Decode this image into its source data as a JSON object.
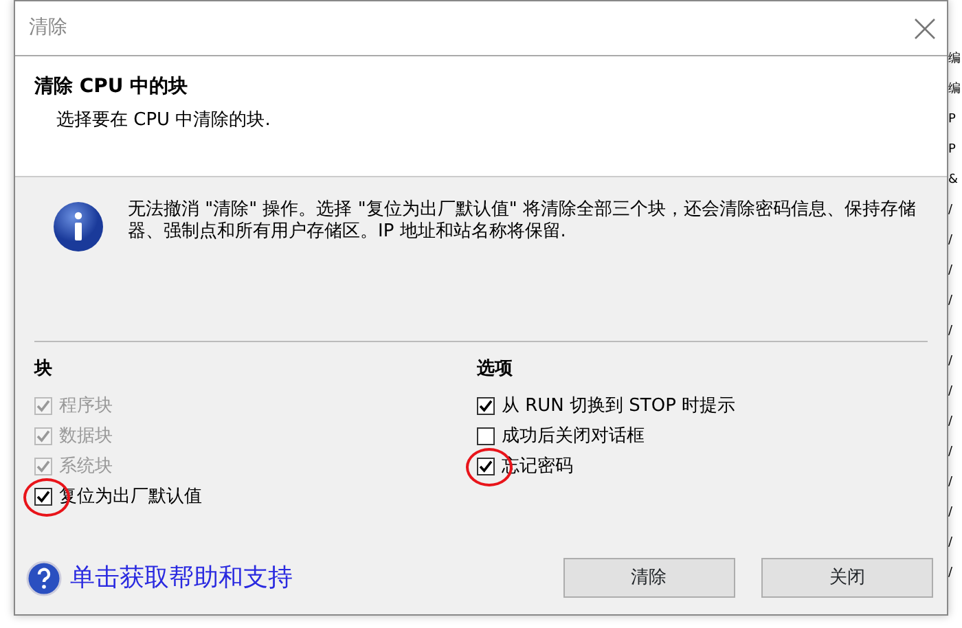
{
  "window": {
    "title": "清除"
  },
  "header": {
    "title": "清除 CPU 中的块",
    "subtitle": "选择要在 CPU 中清除的块."
  },
  "info": {
    "message": "无法撤消 \"清除\" 操作。选择 \"复位为出厂默认值\" 将清除全部三个块，还会清除密码信息、保持存储器、强制点和所有用户存储区。IP 地址和站名称将保留."
  },
  "blocks": {
    "title": "块",
    "items": [
      {
        "label": "程序块",
        "checked": true,
        "disabled": true,
        "highlighted": false
      },
      {
        "label": "数据块",
        "checked": true,
        "disabled": true,
        "highlighted": false
      },
      {
        "label": "系统块",
        "checked": true,
        "disabled": true,
        "highlighted": false
      },
      {
        "label": "复位为出厂默认值",
        "checked": true,
        "disabled": false,
        "highlighted": true
      }
    ]
  },
  "options": {
    "title": "选项",
    "items": [
      {
        "label": "从 RUN 切换到 STOP 时提示",
        "checked": true,
        "disabled": false,
        "highlighted": false
      },
      {
        "label": "成功后关闭对话框",
        "checked": false,
        "disabled": false,
        "highlighted": false
      },
      {
        "label": "忘记密码",
        "checked": true,
        "disabled": false,
        "highlighted": true
      }
    ]
  },
  "help_link": "单击获取帮助和支持",
  "buttons": [
    "清除",
    "关闭"
  ],
  "background_window": [
    "编",
    "编",
    "P",
    "P",
    "&",
    "/",
    "/",
    "/",
    "/",
    "/",
    "/",
    "/",
    "/",
    "/",
    "/",
    "/",
    "/",
    "/"
  ]
}
